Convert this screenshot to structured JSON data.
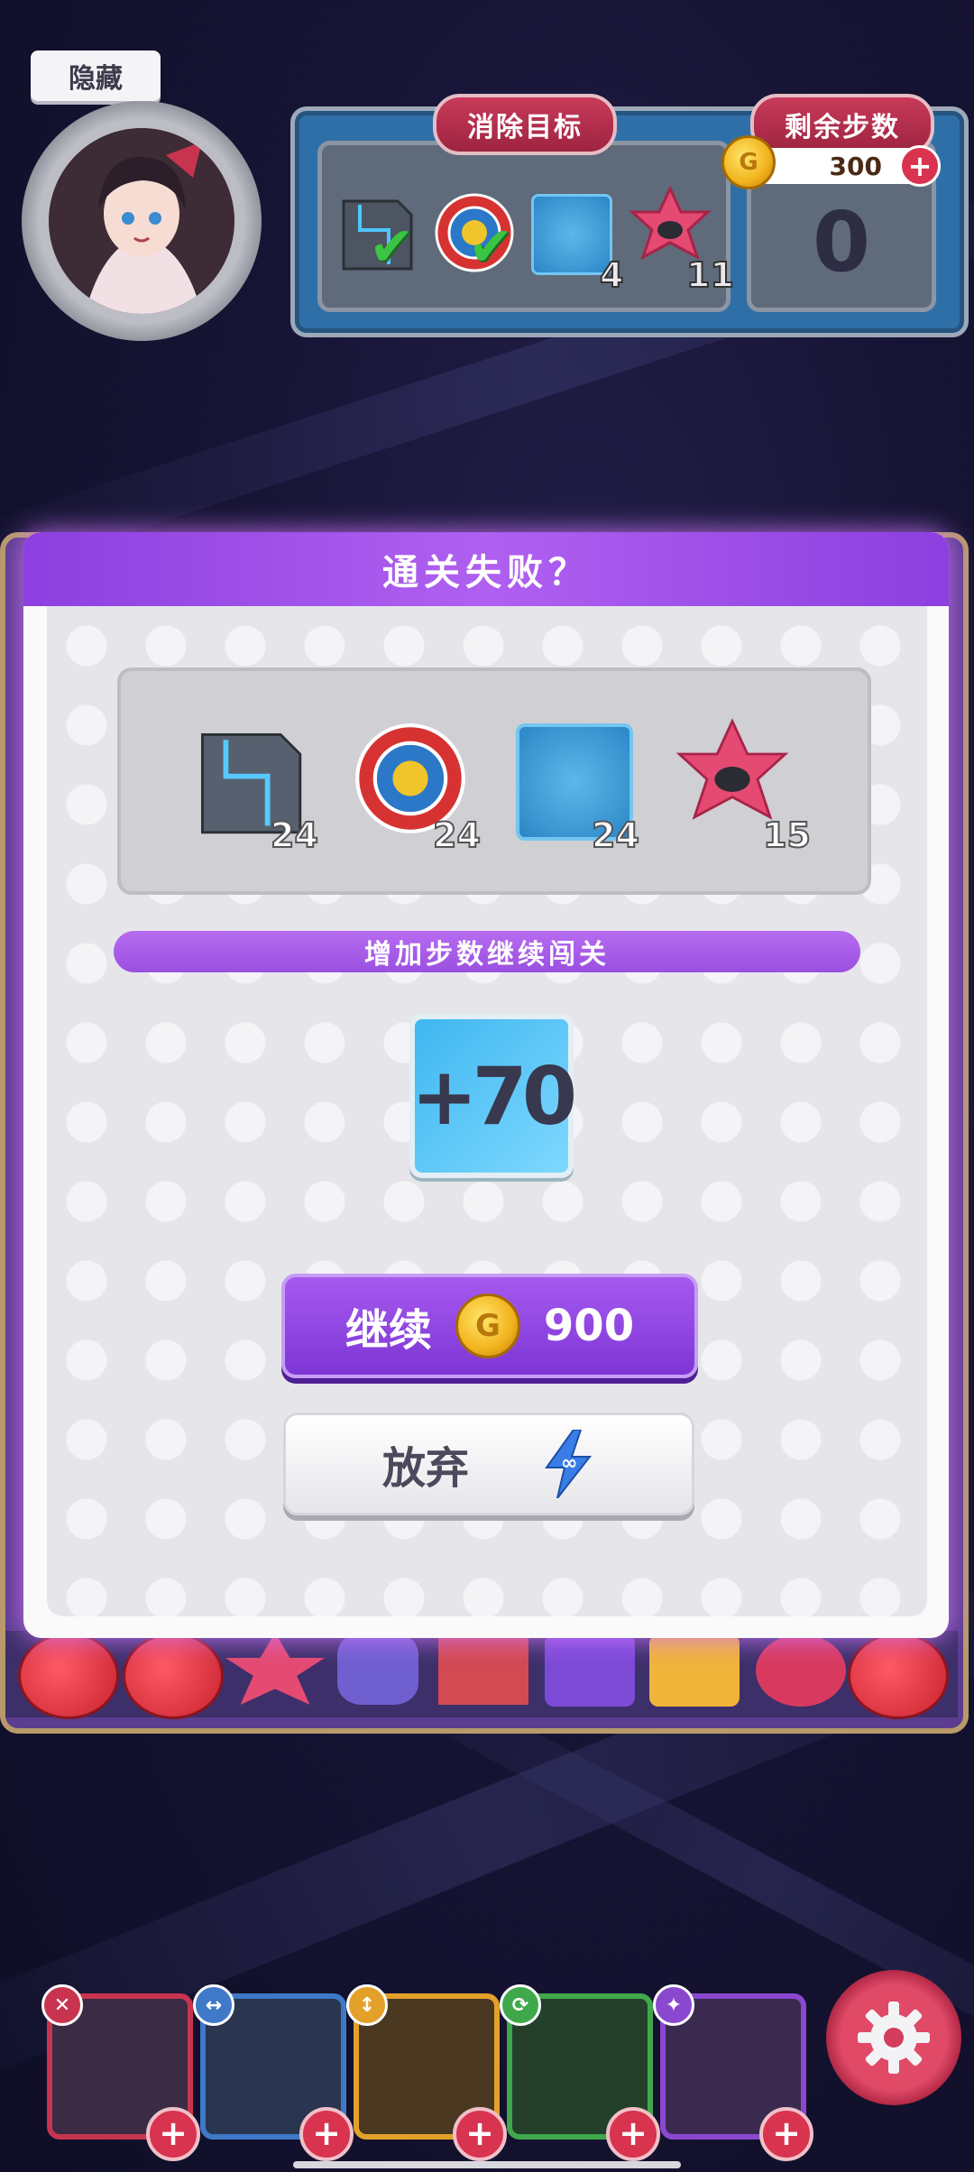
{
  "hud": {
    "hide_label": "隐藏",
    "goal_title": "消除目标",
    "steps_title": "剩余步数",
    "coins": "300",
    "coin_plus": "+",
    "steps_remaining": "0",
    "goals": [
      {
        "icon": "metal-crate-icon",
        "status": "done",
        "count": ""
      },
      {
        "icon": "target-icon",
        "status": "done",
        "count": ""
      },
      {
        "icon": "ice-block-icon",
        "status": "pending",
        "count": "4"
      },
      {
        "icon": "pink-star-icon",
        "status": "pending",
        "count": "11"
      }
    ]
  },
  "dialog": {
    "title": "通关失败？",
    "goals": [
      {
        "icon": "metal-crate-icon",
        "count": "24"
      },
      {
        "icon": "target-icon",
        "count": "24"
      },
      {
        "icon": "ice-block-icon",
        "count": "24"
      },
      {
        "icon": "pink-star-icon",
        "count": "15"
      }
    ],
    "banner": "增加步数继续闯关",
    "bonus": "+70",
    "continue_label": "继续",
    "continue_price": "900",
    "giveup_label": "放弃"
  },
  "colors": {
    "accent_purple": "#8d3fe0",
    "hud_blue": "#2f6fa8",
    "hud_red": "#c83a5a",
    "coin_gold": "#f2b21d"
  },
  "characters": [
    {
      "name": "character-card-1",
      "border": "#c8344f",
      "badge": "close-icon"
    },
    {
      "name": "character-card-2",
      "border": "#3f79c8",
      "badge": "swap-horizontal-icon"
    },
    {
      "name": "character-card-3",
      "border": "#e3a12a",
      "badge": "swap-vertical-icon"
    },
    {
      "name": "character-card-4",
      "border": "#3fa84b",
      "badge": "refresh-icon"
    },
    {
      "name": "character-card-5",
      "border": "#8a48cf",
      "badge": "wand-icon"
    }
  ]
}
